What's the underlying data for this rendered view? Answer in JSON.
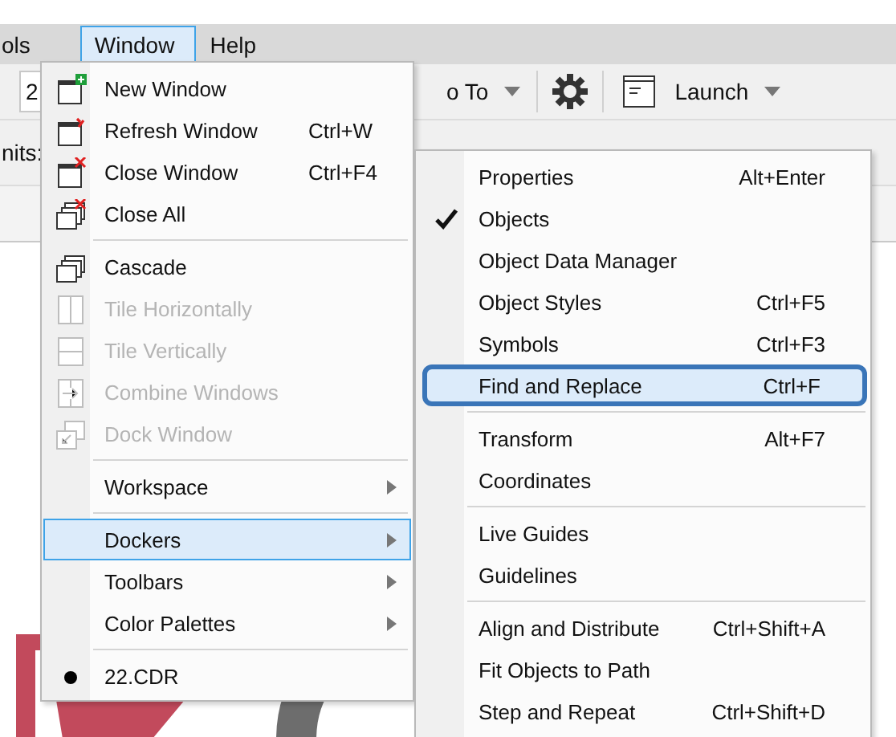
{
  "menubar": [
    {
      "label": "ols",
      "selected": false
    },
    {
      "label": "Window",
      "selected": true
    },
    {
      "label": "Help",
      "selected": false
    }
  ],
  "toolbar": {
    "zoom_field": "2",
    "snap_to": "o To",
    "launch": "Launch"
  },
  "property_bar": {
    "units_label": "nits:"
  },
  "window_menu": [
    {
      "kind": "item",
      "label": "New Window",
      "disabled": false,
      "selected": false
    },
    {
      "kind": "item",
      "label": "Refresh Window",
      "shortcut": "Ctrl+W",
      "disabled": false,
      "selected": false
    },
    {
      "kind": "item",
      "label": "Close Window",
      "shortcut": "Ctrl+F4",
      "disabled": false,
      "selected": false
    },
    {
      "kind": "item",
      "label": "Close All",
      "disabled": false,
      "selected": false
    },
    {
      "kind": "separator"
    },
    {
      "kind": "item",
      "label": "Cascade",
      "disabled": false,
      "selected": false
    },
    {
      "kind": "item",
      "label": "Tile Horizontally",
      "disabled": true,
      "selected": false
    },
    {
      "kind": "item",
      "label": "Tile Vertically",
      "disabled": true,
      "selected": false
    },
    {
      "kind": "item",
      "label": "Combine Windows",
      "disabled": true,
      "selected": false
    },
    {
      "kind": "item",
      "label": "Dock Window",
      "disabled": true,
      "selected": false
    },
    {
      "kind": "separator"
    },
    {
      "kind": "submenu",
      "label": "Workspace",
      "disabled": false,
      "selected": false
    },
    {
      "kind": "separator"
    },
    {
      "kind": "submenu",
      "label": "Dockers",
      "disabled": false,
      "selected": true
    },
    {
      "kind": "submenu",
      "label": "Toolbars",
      "disabled": false,
      "selected": false
    },
    {
      "kind": "submenu",
      "label": "Color Palettes",
      "disabled": false,
      "selected": false
    },
    {
      "kind": "separator"
    },
    {
      "kind": "document",
      "label": "22.CDR",
      "active": true,
      "disabled": false,
      "selected": false
    }
  ],
  "dockers_menu": [
    {
      "kind": "item",
      "label": "Properties",
      "shortcut": "Alt+Enter",
      "checked": false,
      "selected": false
    },
    {
      "kind": "item",
      "label": "Objects",
      "checked": true,
      "selected": false
    },
    {
      "kind": "item",
      "label": "Object Data Manager",
      "checked": false,
      "selected": false
    },
    {
      "kind": "item",
      "label": "Object Styles",
      "shortcut": "Ctrl+F5",
      "checked": false,
      "selected": false
    },
    {
      "kind": "item",
      "label": "Symbols",
      "shortcut": "Ctrl+F3",
      "checked": false,
      "selected": false
    },
    {
      "kind": "item",
      "label": "Find and Replace",
      "shortcut": "Ctrl+F",
      "checked": false,
      "selected": true
    },
    {
      "kind": "separator"
    },
    {
      "kind": "item",
      "label": "Transform",
      "shortcut": "Alt+F7",
      "checked": false,
      "selected": false
    },
    {
      "kind": "item",
      "label": "Coordinates",
      "checked": false,
      "selected": false
    },
    {
      "kind": "separator"
    },
    {
      "kind": "item",
      "label": "Live Guides",
      "checked": false,
      "selected": false
    },
    {
      "kind": "item",
      "label": "Guidelines",
      "checked": false,
      "selected": false
    },
    {
      "kind": "separator"
    },
    {
      "kind": "item",
      "label": "Align and Distribute",
      "shortcut": "Ctrl+Shift+A",
      "checked": false,
      "selected": false
    },
    {
      "kind": "item",
      "label": "Fit Objects to Path",
      "checked": false,
      "selected": false
    },
    {
      "kind": "item",
      "label": "Step and Repeat",
      "shortcut": "Ctrl+Shift+D",
      "checked": false,
      "selected": false
    }
  ]
}
